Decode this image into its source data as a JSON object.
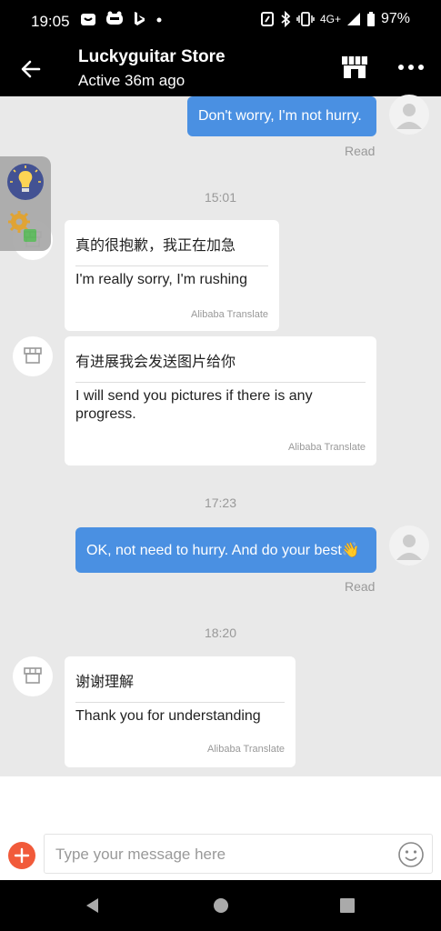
{
  "status_bar": {
    "time": "19:05",
    "network": "4G+",
    "battery": "97%",
    "icons": [
      "wallet-icon",
      "sms-icon",
      "bing-icon",
      "dot-icon",
      "nfc-icon",
      "bluetooth-icon",
      "vibrate-icon",
      "signal-icon",
      "battery-icon"
    ]
  },
  "header": {
    "title": "Luckyguitar Store",
    "subtitle": "Active 36m ago"
  },
  "messages": [
    {
      "type": "sent",
      "text": "Don't worry, I'm not hurry.",
      "status": "Read"
    },
    {
      "type": "time",
      "text": "15:01"
    },
    {
      "type": "received",
      "original": "真的很抱歉，我正在加急",
      "translated": "I'm really sorry, I'm rushing",
      "source": "Alibaba Translate"
    },
    {
      "type": "received",
      "original": "有进展我会发送图片给你",
      "translated": "I will send you pictures if there is any progress.",
      "source": "Alibaba Translate"
    },
    {
      "type": "time",
      "text": "17:23"
    },
    {
      "type": "sent",
      "text": "OK, not need to hurry. And do your best👋",
      "status": "Read"
    },
    {
      "type": "time",
      "text": "18:20"
    },
    {
      "type": "received",
      "original": "谢谢理解",
      "translated": "Thank you for understanding",
      "source": "Alibaba Translate"
    }
  ],
  "input": {
    "placeholder": "Type your message here"
  },
  "colors": {
    "bar_bg": "#000000",
    "chat_bg": "#e9e9e9",
    "sent_bubble": "#4a90e2",
    "add_button": "#f15a3a",
    "muted_text": "#999999"
  }
}
